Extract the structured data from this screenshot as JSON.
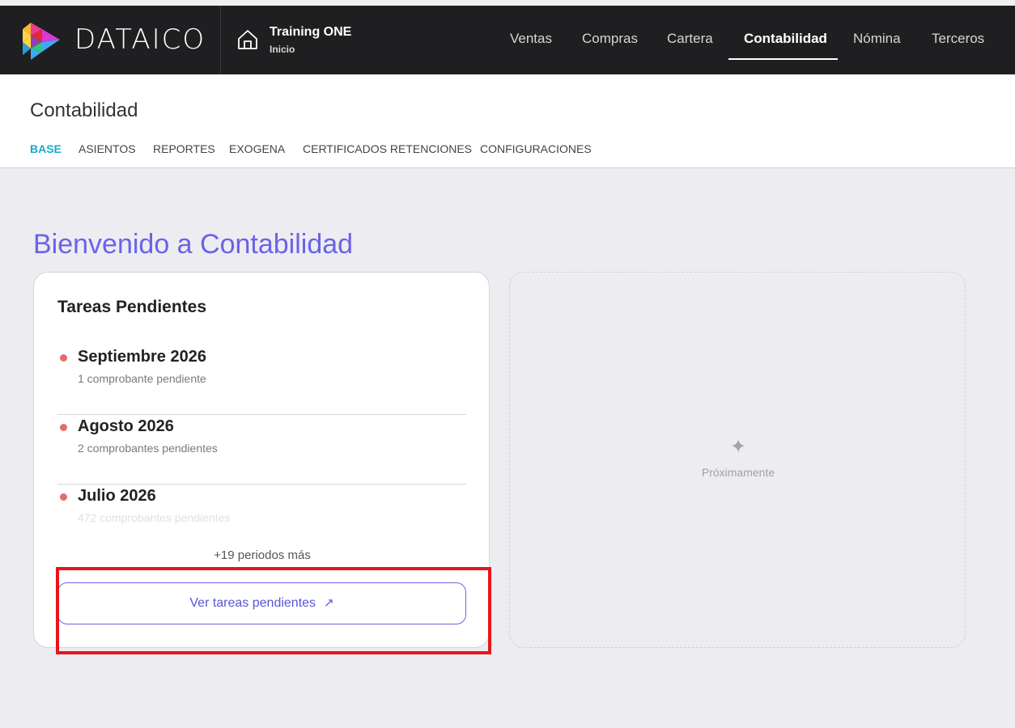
{
  "app": {
    "brand": "DATAICO",
    "company_name": "Training ONE",
    "company_sub": "Inicio"
  },
  "main_nav": {
    "items": [
      {
        "label": "Ventas",
        "active": false
      },
      {
        "label": "Compras",
        "active": false
      },
      {
        "label": "Cartera",
        "active": false
      },
      {
        "label": "Contabilidad",
        "active": true
      },
      {
        "label": "Nómina",
        "active": false
      },
      {
        "label": "Terceros",
        "active": false
      }
    ]
  },
  "section": {
    "title": "Contabilidad",
    "tabs": [
      {
        "label": "BASE",
        "active": true
      },
      {
        "label": "ASIENTOS",
        "active": false
      },
      {
        "label": "REPORTES",
        "active": false
      },
      {
        "label": "EXOGENA",
        "active": false
      },
      {
        "label": "CERTIFICADOS RETENCIONES",
        "active": false
      },
      {
        "label": "CONFIGURACIONES",
        "active": false
      }
    ]
  },
  "welcome": "Bienvenido a Contabilidad",
  "tasks_card": {
    "title": "Tareas Pendientes",
    "periods": [
      {
        "name": "Septiembre 2026",
        "count": "1 comprobante pendiente"
      },
      {
        "name": "Agosto 2026",
        "count": "2 comprobantes pendientes"
      },
      {
        "name": "Julio 2026",
        "count": "472 comprobantes pendientes"
      }
    ],
    "more": "+19 periodos más",
    "button_label": "Ver tareas pendientes",
    "button_icon": "external-arrow-icon"
  },
  "placeholder": {
    "icon": "sparkle-icon",
    "text": "Próximamente"
  },
  "colors": {
    "topbar": "#1f1f21",
    "accent": "#6a63e8",
    "tab_active": "#19a9c4",
    "pending_dot": "#e06c6c",
    "highlight": "#e8151b"
  }
}
